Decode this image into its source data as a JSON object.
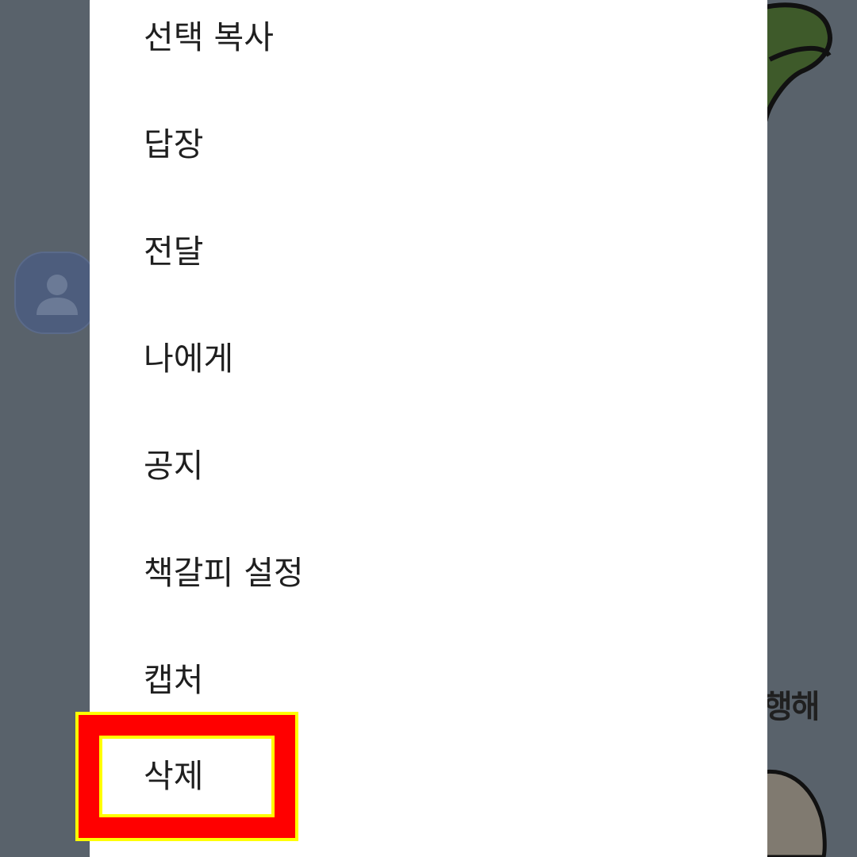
{
  "menu": {
    "items": [
      {
        "label": "선택 복사"
      },
      {
        "label": "답장"
      },
      {
        "label": "전달"
      },
      {
        "label": "나에게"
      },
      {
        "label": "공지"
      },
      {
        "label": "책갈피 설정"
      },
      {
        "label": "캡처"
      },
      {
        "label": "삭제"
      }
    ]
  },
  "background": {
    "sticker_text": "행해",
    "avatar_icon": "person-icon"
  },
  "colors": {
    "dim_overlay": "#59626b",
    "menu_bg": "#ffffff",
    "highlight_outer": "#ff0000",
    "highlight_border": "#ffff00"
  }
}
